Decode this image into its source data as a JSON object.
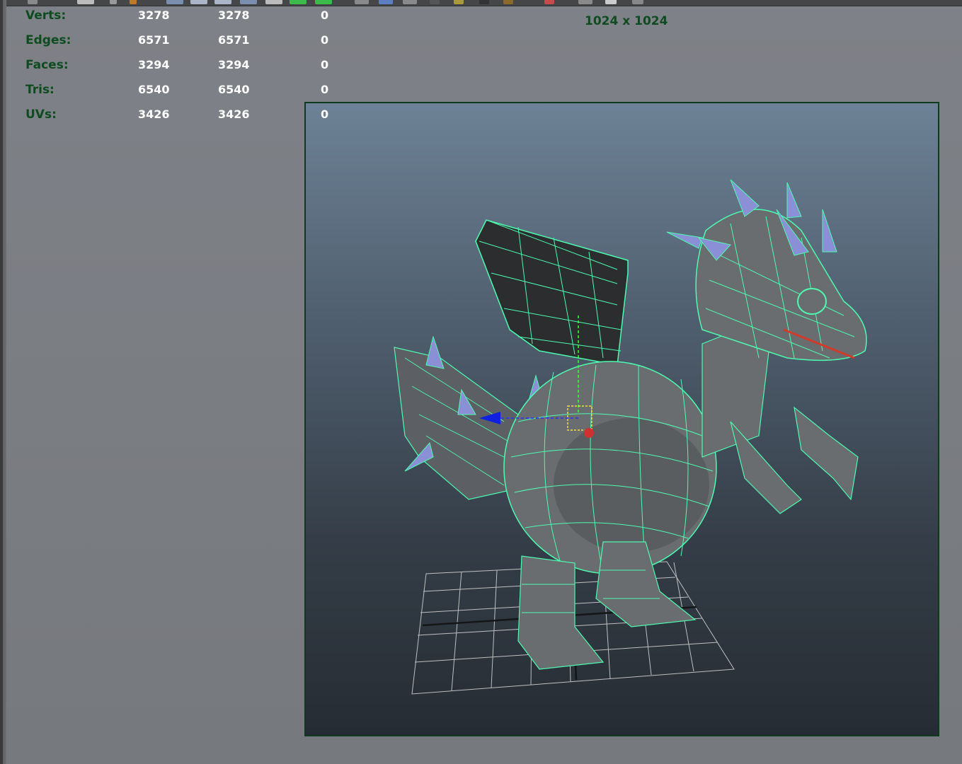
{
  "hud": {
    "rows": [
      {
        "label": "Verts:",
        "v1": "3278",
        "v2": "3278",
        "v3": "0"
      },
      {
        "label": "Edges:",
        "v1": "6571",
        "v2": "6571",
        "v3": "0"
      },
      {
        "label": "Faces:",
        "v1": "3294",
        "v2": "3294",
        "v3": "0"
      },
      {
        "label": "Tris:",
        "v1": "6540",
        "v2": "6540",
        "v3": "0"
      },
      {
        "label": "UVs:",
        "v1": "3426",
        "v2": "3426",
        "v3": "0"
      }
    ]
  },
  "resolution_gate": "1024 x 1024",
  "colors": {
    "hud_label": "#0e4c20",
    "wireframe": "#4dfbb0",
    "mesh_shade": "#6a6d70",
    "horn": "#8a8fd6"
  }
}
